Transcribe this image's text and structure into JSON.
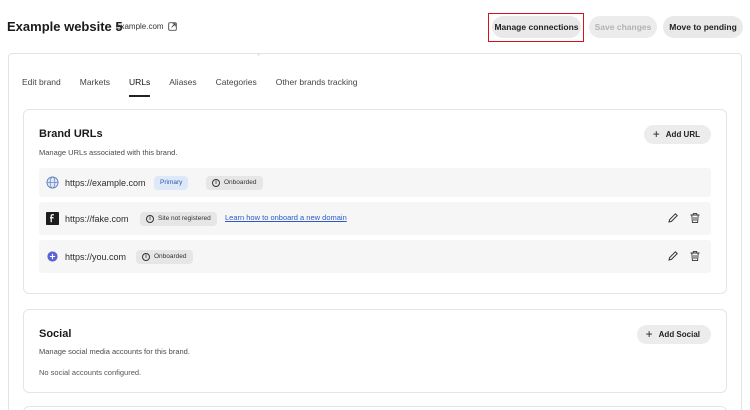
{
  "header": {
    "title": "Example website 5",
    "domain": "example.com",
    "buttons": {
      "manage_connections": "Manage connections",
      "save_changes": "Save changes",
      "move_to_pending": "Move to pending"
    }
  },
  "tabs": [
    {
      "label": "Edit brand",
      "active": false
    },
    {
      "label": "Markets",
      "active": false
    },
    {
      "label": "URLs",
      "active": true
    },
    {
      "label": "Aliases",
      "active": false
    },
    {
      "label": "Categories",
      "active": false
    },
    {
      "label": "Other brands tracking",
      "active": false
    }
  ],
  "brand_urls": {
    "title": "Brand URLs",
    "description": "Manage URLs associated with this brand.",
    "add_label": "Add URL",
    "rows": [
      {
        "icon": "globe-icon",
        "url": "https://example.com",
        "primary_badge": "Primary",
        "status": "Onboarded",
        "link": "",
        "editable": false
      },
      {
        "icon": "favicon-f-icon",
        "url": "https://fake.com",
        "primary_badge": "",
        "status": "Site not registered",
        "link": "Learn how to onboard a new domain",
        "editable": true
      },
      {
        "icon": "favicon-circle-icon",
        "url": "https://you.com",
        "primary_badge": "",
        "status": "Onboarded",
        "link": "",
        "editable": true
      }
    ]
  },
  "social": {
    "title": "Social",
    "description": "Manage social media accounts for this brand.",
    "add_label": "Add Social",
    "empty_text": "No social accounts configured."
  },
  "misc": {
    "stray_mark": "˙"
  },
  "colors": {
    "highlight_border": "#d4131c",
    "primary_badge_bg": "#dde8f8",
    "link": "#2a5ac7"
  }
}
